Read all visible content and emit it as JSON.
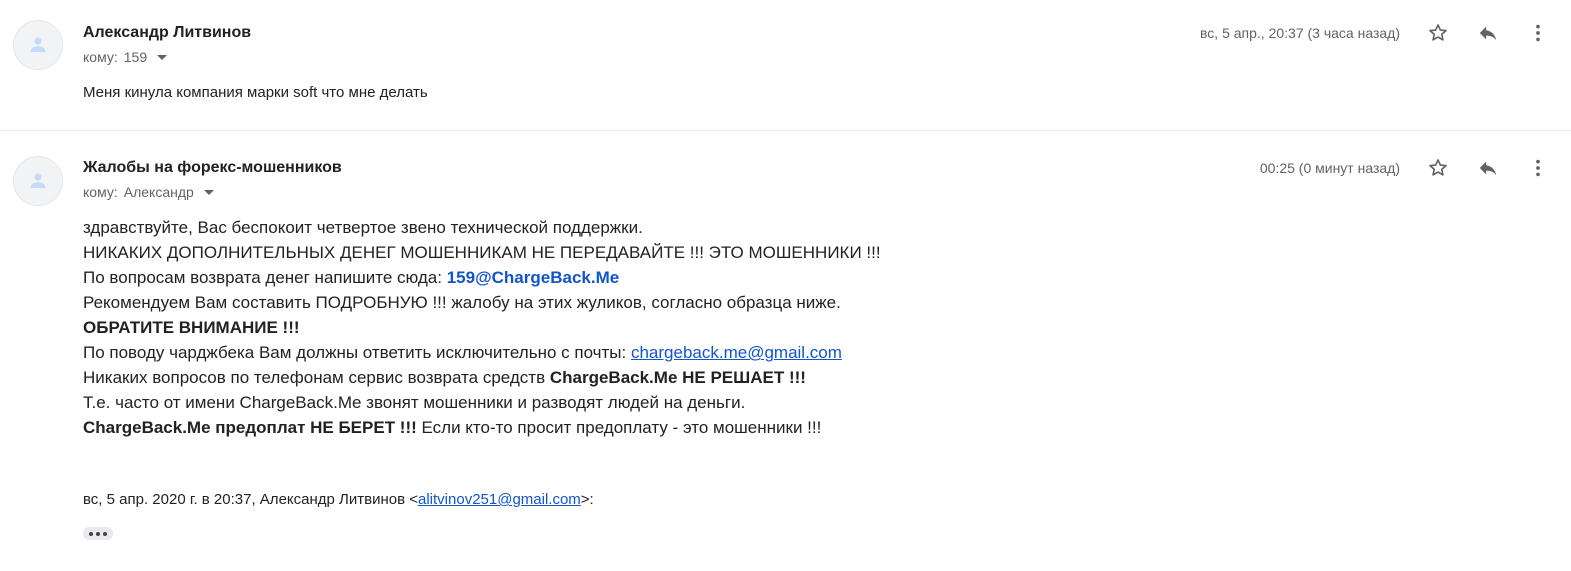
{
  "messages": [
    {
      "sender": "Александр Литвинов",
      "to_label": "кому:",
      "to_value": "159",
      "date": "вс, 5 апр., 20:37 (3 часа назад)",
      "snippet": "Меня кинула компания марки soft что мне делать"
    },
    {
      "sender": "Жалобы на форекс-мошенников",
      "to_label": "кому:",
      "to_value": "Александр",
      "date": "00:25 (0 минут назад)",
      "body": {
        "l1": "здравствуйте, Вас беспокоит четвертое звено технической поддержки.",
        "l2": "НИКАКИХ ДОПОЛНИТЕЛЬНЫХ ДЕНЕГ МОШЕННИКАМ НЕ ПЕРЕДАВАЙТЕ !!! ЭТО МОШЕННИКИ !!!",
        "l3_text": "По вопросам возврата денег напишите сюда: ",
        "l3_email": "159@ChargeBack.Me",
        "l4": "Рекомендуем Вам составить ПОДРОБНУЮ !!! жалобу на этих жуликов, согласно образца ниже.",
        "l5": "ОБРАТИТЕ ВНИМАНИЕ !!!",
        "l6_text": "По поводу чарджбека Вам должны ответить исключительно с почты: ",
        "l6_link": "chargeback.me@gmail.com",
        "l7_text": "Никаких вопросов по телефонам сервис возврата средств ",
        "l7_bold": "ChargeBack.Me НЕ РЕШАЕТ !!!",
        "l8": "Т.е. часто от имени ChargeBack.Me звонят мошенники и разводят людей на деньги.",
        "l9_bold": "ChargeBack.Me предоплат НЕ БЕРЕТ !!!",
        "l9_text": " Если кто-то просит предоплату - это мошенники !!!"
      },
      "quote_header": {
        "prefix": "вс, 5 апр. 2020 г. в 20:37, Александр Литвинов <",
        "email": "alitvinov251@gmail.com",
        "suffix": ">:"
      }
    }
  ],
  "icons": {
    "avatar": "person-icon",
    "star": "star-icon",
    "reply": "reply-icon",
    "more": "more-vert-icon",
    "caret": "caret-down-icon",
    "ellipsis": "ellipsis-icon"
  },
  "colors": {
    "link": "#1155cc",
    "meta_text": "#5f6368",
    "avatar_figure": "#c6dafc"
  }
}
